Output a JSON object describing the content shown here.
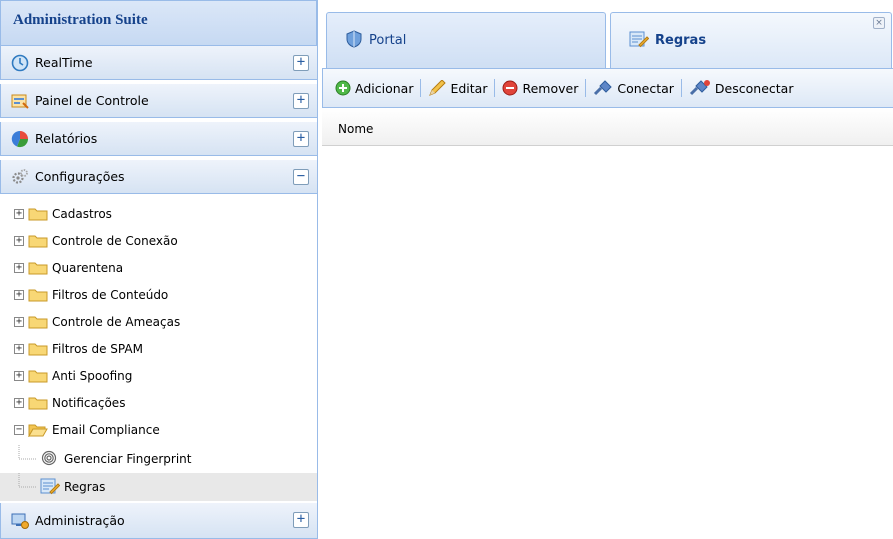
{
  "sidebar": {
    "title": "Administration Suite",
    "sections": [
      {
        "label": "RealTime",
        "icon": "realtime-icon",
        "toggle": "+"
      },
      {
        "label": "Painel de Controle",
        "icon": "control-panel-icon",
        "toggle": "+"
      },
      {
        "label": "Relatórios",
        "icon": "reports-pie-icon",
        "toggle": "+"
      },
      {
        "label": "Configurações",
        "icon": "gears-icon",
        "toggle": "−"
      }
    ],
    "footer_section": {
      "label": "Administração",
      "icon": "admin-monitor-icon",
      "toggle": "+"
    },
    "tree": [
      {
        "label": "Cadastros",
        "expander": "+"
      },
      {
        "label": "Controle de Conexão",
        "expander": "+"
      },
      {
        "label": "Quarentena",
        "expander": "+"
      },
      {
        "label": "Filtros de Conteúdo",
        "expander": "+"
      },
      {
        "label": "Controle de Ameaças",
        "expander": "+"
      },
      {
        "label": "Filtros de SPAM",
        "expander": "+"
      },
      {
        "label": "Anti Spoofing",
        "expander": "+"
      },
      {
        "label": "Notificações",
        "expander": "+"
      },
      {
        "label": "Email Compliance",
        "expander": "−"
      },
      {
        "label": "Gerenciar Fingerprint"
      },
      {
        "label": "Regras"
      }
    ]
  },
  "main": {
    "tabs": [
      {
        "label": "Portal",
        "icon": "portal-shield-icon",
        "active": false
      },
      {
        "label": "Regras",
        "icon": "rules-edit-icon",
        "active": true,
        "close": "×"
      }
    ],
    "toolbar": {
      "add_label": "Adicionar",
      "edit_label": "Editar",
      "remove_label": "Remover",
      "connect_label": "Conectar",
      "disconnect_label": "Desconectar"
    },
    "grid": {
      "columns": [
        "Nome"
      ]
    }
  },
  "colors": {
    "header_text": "#15428b",
    "border": "#99bbe8",
    "selected_row": "#e8e8e8"
  }
}
